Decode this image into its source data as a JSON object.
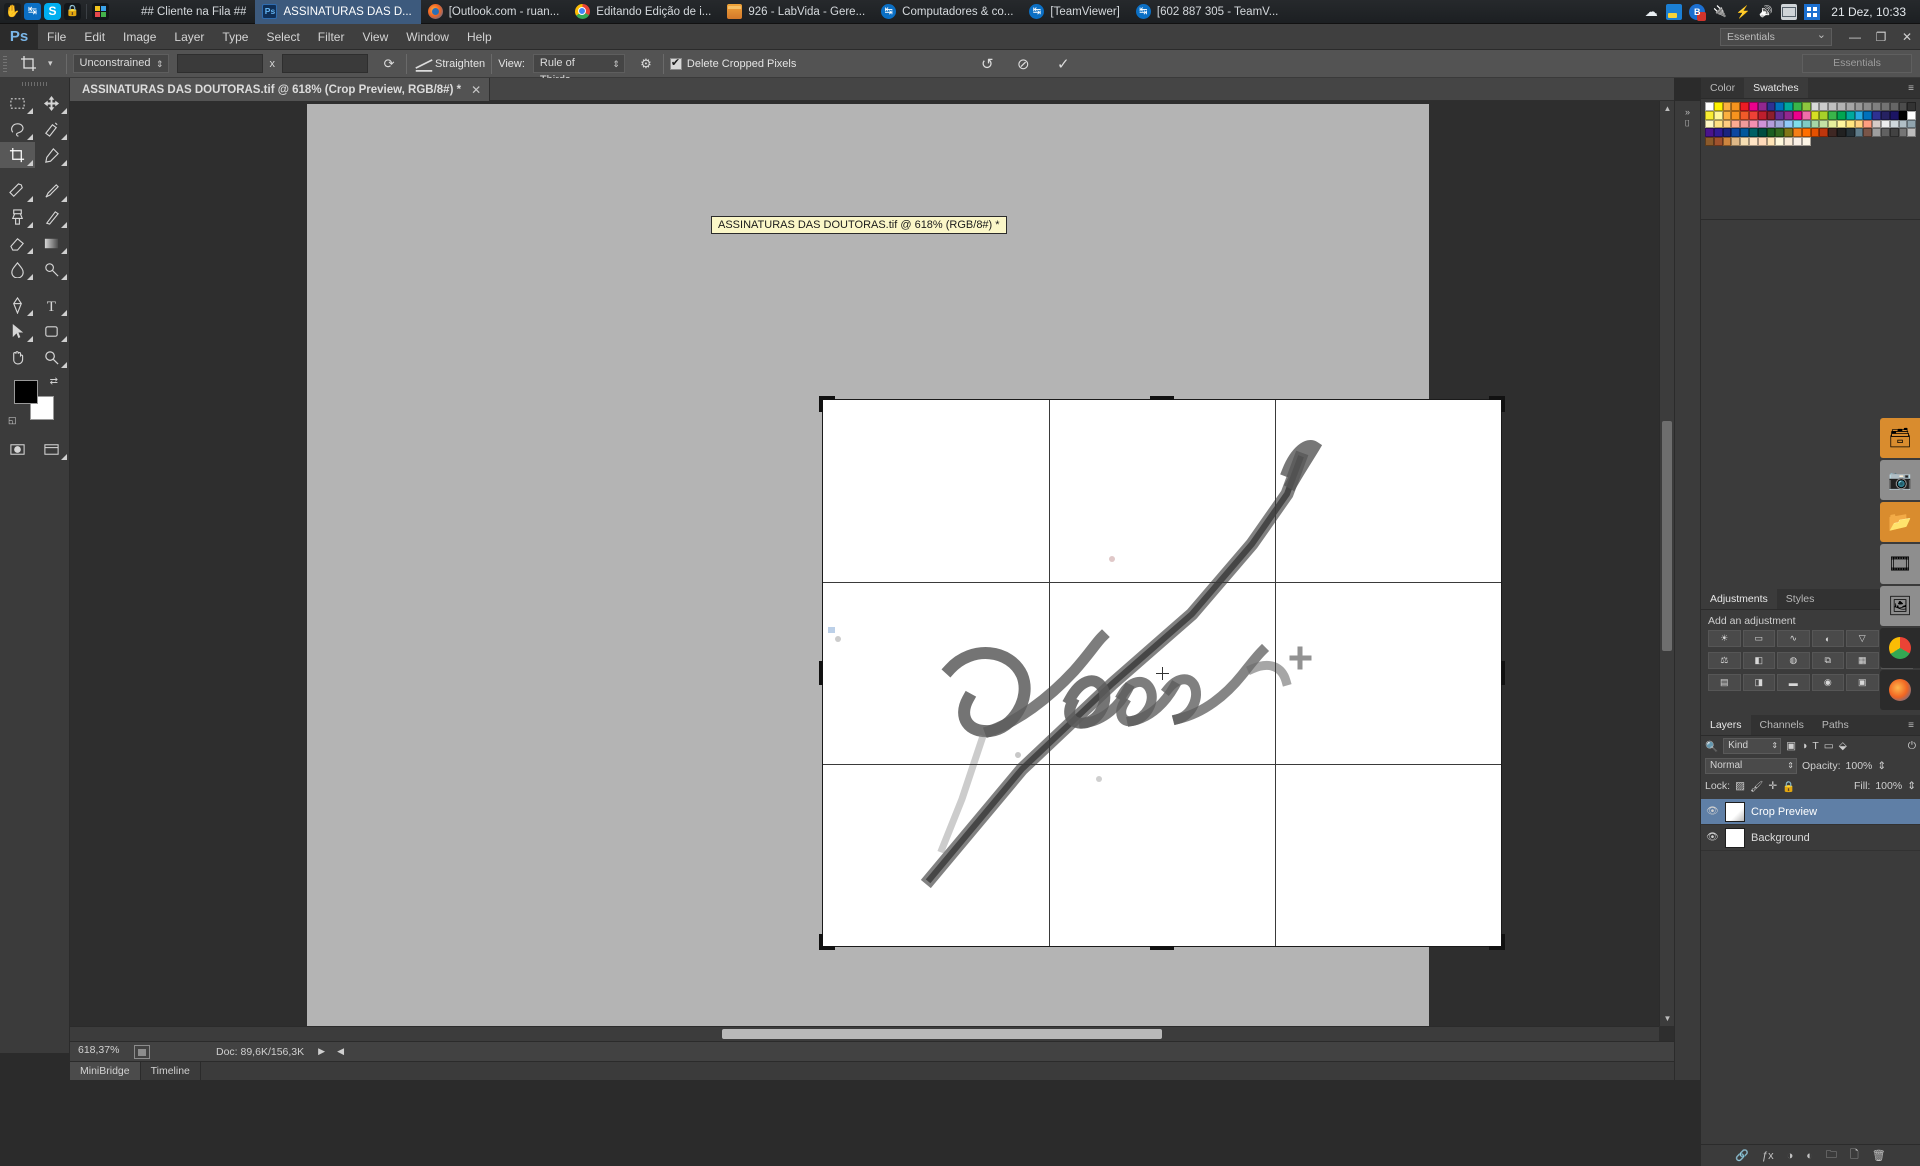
{
  "taskbar": {
    "quick_icons": [
      "hand-icon",
      "teamviewer-icon",
      "skype-icon",
      "lock-icon",
      "tiles-icon"
    ],
    "tasks": [
      {
        "label": "## Cliente na Fila ##",
        "icon": "none-icon",
        "active": false
      },
      {
        "label": "ASSINATURAS DAS D...",
        "icon": "photoshop-icon",
        "active": true
      },
      {
        "label": "[Outlook.com - ruan...",
        "icon": "firefox-icon",
        "active": false
      },
      {
        "label": "Editando Edição de i...",
        "icon": "chrome-icon",
        "active": false
      },
      {
        "label": "926 - LabVida - Gere...",
        "icon": "folder-icon",
        "active": false
      },
      {
        "label": "Computadores & co...",
        "icon": "teamviewer-icon",
        "active": false
      },
      {
        "label": "[TeamViewer]",
        "icon": "teamviewer-icon",
        "active": false
      },
      {
        "label": "[602 887 305 - TeamV...",
        "icon": "teamviewer-icon",
        "active": false
      }
    ],
    "tray_icons": [
      "cloud-icon",
      "monitor-icon",
      "bluetooth-disabled-icon",
      "plug-icon",
      "flash-icon",
      "sound-icon",
      "mail-icon",
      "windows-icon"
    ],
    "clock": "21 Dez, 10:33"
  },
  "menubar": {
    "logo": "Ps",
    "items": [
      "File",
      "Edit",
      "Image",
      "Layer",
      "Type",
      "Select",
      "Filter",
      "View",
      "Window",
      "Help"
    ],
    "workspace": "Essentials",
    "window_buttons": {
      "minimize": "—",
      "restore": "❐",
      "close": "✕"
    }
  },
  "options_bar": {
    "tool": "crop-tool",
    "ratio_preset": "Unconstrained",
    "width_value": "",
    "height_value": "",
    "x_separator": "x",
    "swap_label": "⟳",
    "straighten_label": "Straighten",
    "view_label": "View:",
    "view_value": "Rule of Thirds",
    "settings_label": "gear-icon",
    "delete_cropped_label": "Delete Cropped Pixels",
    "delete_cropped_checked": true,
    "reset_label": "↺",
    "cancel_label": "⊘",
    "commit_label": "✓"
  },
  "document_tab": {
    "title": "ASSINATURAS DAS DOUTORAS.tif @ 618% (Crop Preview, RGB/8#) *",
    "close": "✕"
  },
  "floating_title": "ASSINATURAS DAS DOUTORAS.tif @ 618% (RGB/8#) *",
  "toolbox": {
    "tools": [
      [
        "marquee-tool",
        "move-tool"
      ],
      [
        "lasso-tool",
        "quick-select-tool"
      ],
      [
        "crop-tool",
        "eyedropper-tool"
      ],
      [
        "spot-heal-tool",
        "brush-tool"
      ],
      [
        "clone-stamp-tool",
        "history-brush-tool"
      ],
      [
        "eraser-tool",
        "gradient-tool"
      ],
      [
        "blur-tool",
        "dodge-tool"
      ],
      [
        "pen-tool",
        "type-tool"
      ],
      [
        "path-select-tool",
        "shape-tool"
      ],
      [
        "hand-tool",
        "zoom-tool"
      ]
    ],
    "extra": [
      "quick-mask-tool",
      "screen-mode-tool"
    ],
    "foreground_color": "#000000",
    "background_color": "#ffffff"
  },
  "status_bar": {
    "zoom": "618,37%",
    "doc_info": "Doc: 89,6K/156,3K",
    "arrow": "▶",
    "arrow2": "◀"
  },
  "bottom_bar": {
    "tabs": [
      {
        "label": "MiniBridge",
        "active": true
      },
      {
        "label": "Timeline",
        "active": false
      }
    ]
  },
  "panels": {
    "color_swatches": {
      "tabs": [
        {
          "label": "Color",
          "active": false
        },
        {
          "label": "Swatches",
          "active": true
        }
      ],
      "menu": "≡",
      "swatch_colors": [
        "#ffffff",
        "#fff200",
        "#fcb040",
        "#f7941e",
        "#ed1c24",
        "#ec008c",
        "#92278f",
        "#2e3192",
        "#0071bc",
        "#00a99d",
        "#39b54a",
        "#8dc63f",
        "#d9d9d9",
        "#cccccc",
        "#bfbfbf",
        "#b3b3b3",
        "#a6a6a6",
        "#999999",
        "#8c8c8c",
        "#808080",
        "#737373",
        "#666666",
        "#4d4d4d",
        "#333333",
        "#f9ed32",
        "#fff799",
        "#fbb040",
        "#f7941e",
        "#f15a29",
        "#ef4136",
        "#be1e2d",
        "#8c1f2c",
        "#662d91",
        "#92278f",
        "#ec008c",
        "#f06eaa",
        "#d7df23",
        "#a7d129",
        "#39b54a",
        "#00a651",
        "#00a99d",
        "#27aae1",
        "#0071bc",
        "#2e3192",
        "#262262",
        "#1b1464",
        "#000000",
        "#ffffff",
        "#fff9c4",
        "#ffe082",
        "#ffcc80",
        "#ffab91",
        "#ef9a9a",
        "#f48fb1",
        "#ce93d8",
        "#b39ddb",
        "#9fa8da",
        "#90caf9",
        "#80deea",
        "#80cbc4",
        "#a5d6a7",
        "#c5e1a5",
        "#e6ee9c",
        "#fff59d",
        "#ffe57f",
        "#ffd180",
        "#ff9e80",
        "#d7ccc8",
        "#eeeeee",
        "#cfd8dc",
        "#b0bec5",
        "#90a4ae",
        "#4a148c",
        "#311b92",
        "#1a237e",
        "#0d47a1",
        "#01579b",
        "#006064",
        "#004d40",
        "#1b5e20",
        "#33691e",
        "#827717",
        "#f57f17",
        "#ff6f00",
        "#e65100",
        "#bf360c",
        "#3e2723",
        "#212121",
        "#263238",
        "#607d8b",
        "#795548",
        "#9e9e9e",
        "#616161",
        "#424242",
        "#757575",
        "#bdbdbd",
        "#8b5a2b",
        "#a0522d",
        "#cd853f",
        "#deb887",
        "#f5deb3",
        "#ffe4c4",
        "#ffdab9",
        "#ffe4b5",
        "#fff8dc",
        "#faebd7",
        "#faf0e6",
        "#fdf5e6"
      ]
    },
    "adjustments": {
      "tabs": [
        {
          "label": "Adjustments",
          "active": true
        },
        {
          "label": "Styles",
          "active": false
        }
      ],
      "menu": "≡",
      "title": "Add an adjustment",
      "buttons_row1": [
        "brightness-contrast-icon",
        "levels-icon",
        "curves-icon",
        "exposure-icon",
        "vibrance-icon",
        "hue-saturation-icon"
      ],
      "buttons_row2": [
        "color-balance-icon",
        "black-white-icon",
        "photo-filter-icon",
        "channel-mixer-icon",
        "color-lookup-icon",
        "invert-icon"
      ],
      "buttons_row3": [
        "posterize-icon",
        "threshold-icon",
        "gradient-map-icon",
        "selective-color-icon",
        "map-icon",
        "extra-icon"
      ]
    },
    "layers": {
      "tabs": [
        {
          "label": "Layers",
          "active": true
        },
        {
          "label": "Channels",
          "active": false
        },
        {
          "label": "Paths",
          "active": false
        }
      ],
      "menu": "≡",
      "filter_label": "Kind",
      "blend_mode": "Normal",
      "opacity_label": "Opacity:",
      "opacity_value": "100%",
      "lock_label": "Lock:",
      "fill_label": "Fill:",
      "fill_value": "100%",
      "items": [
        {
          "name": "Crop Preview",
          "selected": true,
          "visible": true,
          "thumb": "crop"
        },
        {
          "name": "Background",
          "selected": false,
          "visible": true,
          "thumb": "white"
        }
      ],
      "footer_icons": [
        "link-icon",
        "fx-icon",
        "mask-icon",
        "adjustment-icon",
        "group-icon",
        "new-layer-icon",
        "delete-icon"
      ]
    },
    "icon_strip": [
      "mini-bridge-icon",
      "camera-icon",
      "folder-icon",
      "camera-raw-icon",
      "photo-icon",
      "chrome-ball-icon",
      "firefox-ball-icon"
    ]
  },
  "colors": {
    "accent": "#3d5a7d",
    "panel_bg": "#3b3b3b",
    "canvas_bg": "#b4b4b4",
    "layer_selected": "#5f7fa6",
    "tooltip_bg": "#fbf7c8"
  }
}
